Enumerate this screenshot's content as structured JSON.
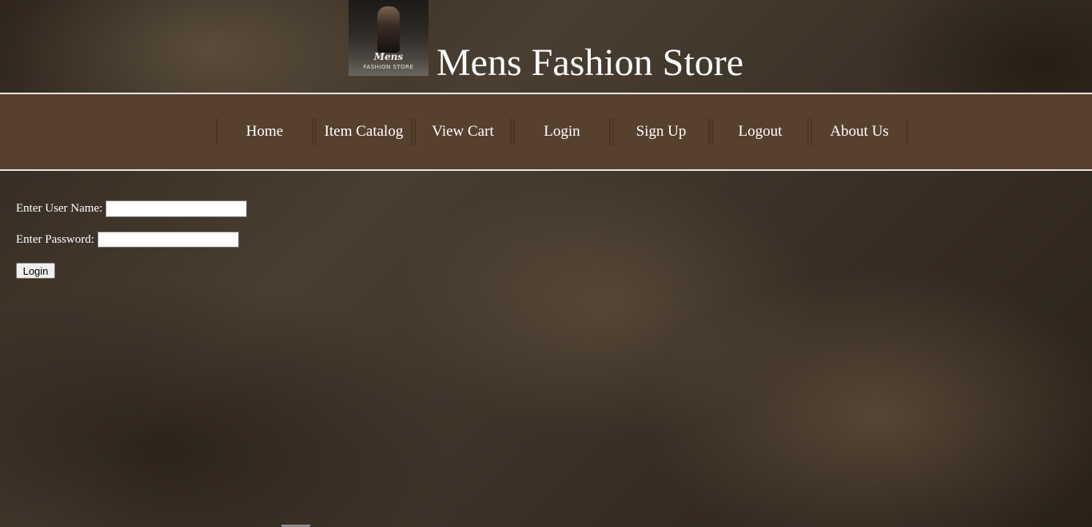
{
  "header": {
    "logo": {
      "brand": "Mens",
      "subtitle": "FASHION STORE"
    },
    "title": "Mens Fashion Store"
  },
  "nav": {
    "items": [
      {
        "label": "Home"
      },
      {
        "label": "Item Catalog"
      },
      {
        "label": "View Cart"
      },
      {
        "label": "Login"
      },
      {
        "label": "Sign Up"
      },
      {
        "label": "Logout"
      },
      {
        "label": "About Us"
      }
    ]
  },
  "login_form": {
    "username_label": "Enter User Name:",
    "username_value": "",
    "password_label": "Enter Password:",
    "password_value": "",
    "submit_label": "Login"
  },
  "colors": {
    "nav_background": "#56412e",
    "nav_border": "#e9e4de",
    "text": "#ffffff"
  }
}
